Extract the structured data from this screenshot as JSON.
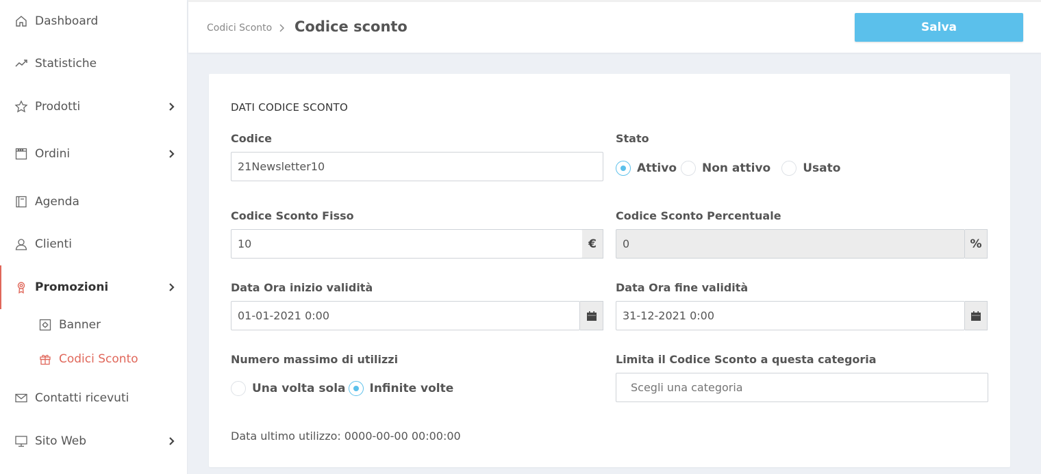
{
  "sidebar": {
    "items": [
      {
        "label": "Dashboard",
        "icon": "home-icon"
      },
      {
        "label": "Statistiche",
        "icon": "trend-icon"
      },
      {
        "label": "Prodotti",
        "icon": "star-icon"
      },
      {
        "label": "Ordini",
        "icon": "calendar-icon"
      },
      {
        "label": "Agenda",
        "icon": "book-icon"
      },
      {
        "label": "Clienti",
        "icon": "user-icon"
      },
      {
        "label": "Promozioni",
        "icon": "badge-icon"
      },
      {
        "label": "Contatti ricevuti",
        "icon": "mail-icon"
      },
      {
        "label": "Sito Web",
        "icon": "monitor-icon"
      }
    ],
    "subitems": [
      {
        "label": "Banner",
        "icon": "banner-icon"
      },
      {
        "label": "Codici Sconto",
        "icon": "gift-icon"
      }
    ],
    "accent_color": "#e0675a"
  },
  "header": {
    "breadcrumb": "Codici Sconto",
    "title": "Codice sconto",
    "save_label": "Salva",
    "save_color": "#5bc0eb"
  },
  "form": {
    "section_title": "DATI CODICE SCONTO",
    "codice": {
      "label": "Codice",
      "value": "21Newsletter10"
    },
    "stato": {
      "label": "Stato",
      "options": [
        "Attivo",
        "Non attivo",
        "Usato"
      ],
      "selected": "Attivo"
    },
    "sconto_fisso": {
      "label": "Codice Sconto Fisso",
      "value": "10",
      "unit": "€"
    },
    "sconto_percentuale": {
      "label": "Codice Sconto Percentuale",
      "value": "0",
      "unit": "%"
    },
    "inizio": {
      "label": "Data Ora inizio validità",
      "value": "01-01-2021 0:00"
    },
    "fine": {
      "label": "Data Ora fine validità",
      "value": "31-12-2021 0:00"
    },
    "utilizzi": {
      "label": "Numero massimo di utilizzi",
      "options": [
        "Una volta sola",
        "Infinite volte"
      ],
      "selected": "Infinite volte"
    },
    "categoria": {
      "label": "Limita il Codice Sconto a questa categoria",
      "placeholder": "Scegli una categoria"
    },
    "ultimo_utilizzo": {
      "label": "Data ultimo utilizzo:",
      "value": "0000-00-00 00:00:00"
    }
  }
}
